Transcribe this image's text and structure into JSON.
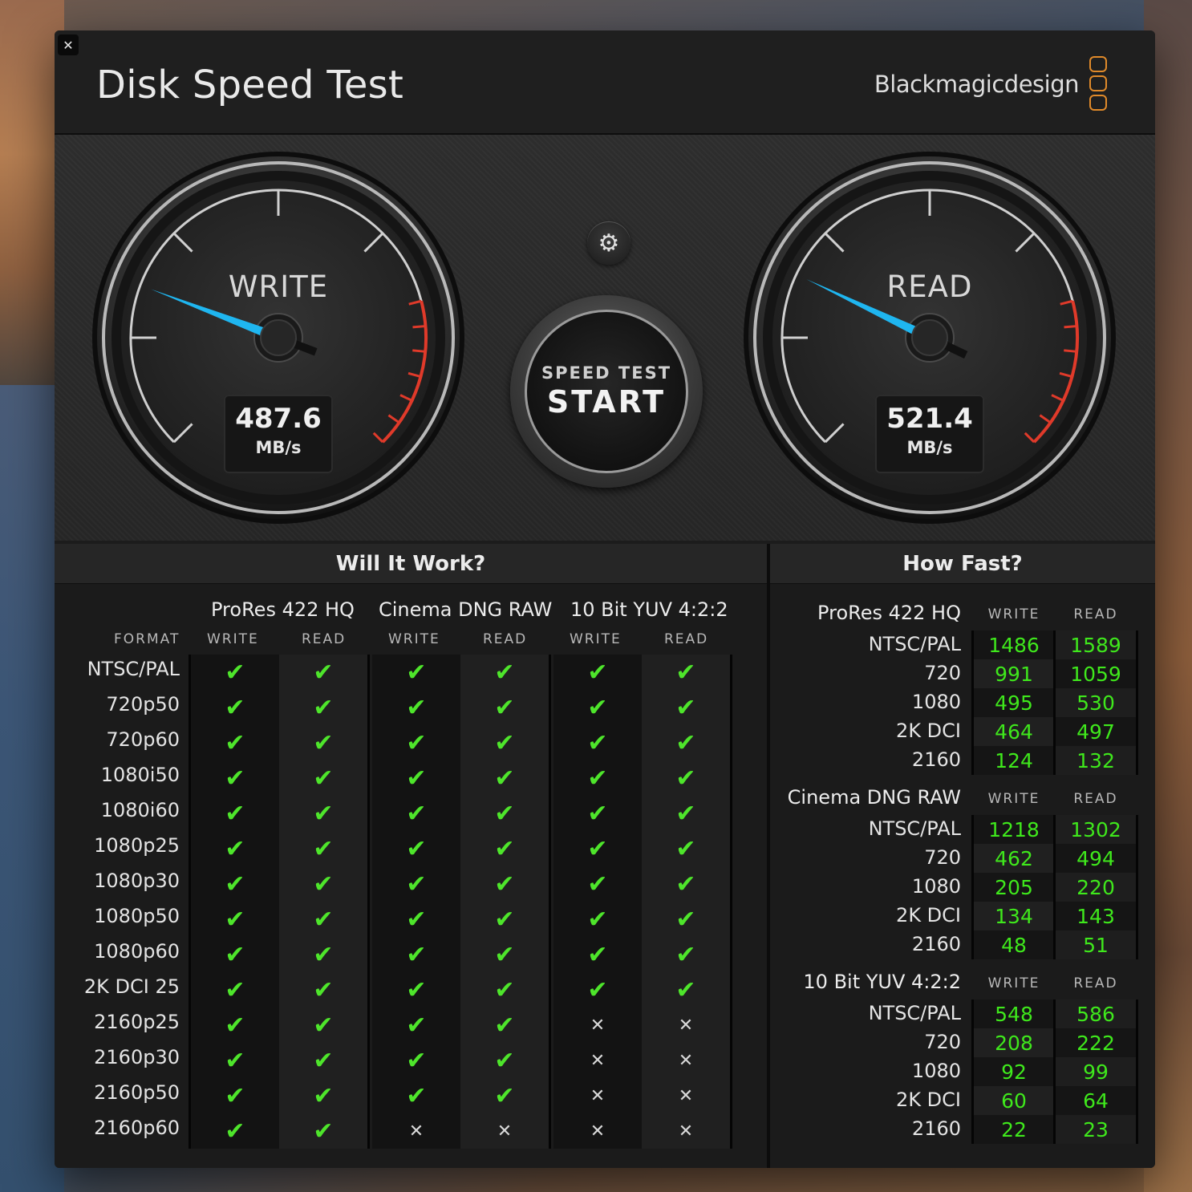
{
  "window": {
    "title": "Disk Speed Test",
    "brand": "Blackmagicdesign",
    "close_icon": "close-icon"
  },
  "gauges": {
    "write": {
      "label": "WRITE",
      "value": "487.6",
      "unit": "MB/s",
      "reading": 487.6
    },
    "read": {
      "label": "READ",
      "value": "521.4",
      "unit": "MB/s",
      "reading": 521.4
    }
  },
  "controls": {
    "start_top": "SPEED TEST",
    "start_main": "START",
    "settings_icon": "gear-icon"
  },
  "colors": {
    "needle": "#1fb6f0",
    "redline": "#e03a2a",
    "ok": "#4ee52b",
    "value": "#3fe81c",
    "brand_logo": "#e08a2a"
  },
  "will_it_work": {
    "title": "Will It Work?",
    "format_header": "FORMAT",
    "groups": [
      {
        "name": "ProRes 422 HQ",
        "write": "WRITE",
        "read": "READ"
      },
      {
        "name": "Cinema DNG RAW",
        "write": "WRITE",
        "read": "READ"
      },
      {
        "name": "10 Bit YUV 4:2:2",
        "write": "WRITE",
        "read": "READ"
      }
    ],
    "rows": [
      {
        "format": "NTSC/PAL",
        "result": [
          1,
          1,
          1,
          1,
          1,
          1
        ]
      },
      {
        "format": "720p50",
        "result": [
          1,
          1,
          1,
          1,
          1,
          1
        ]
      },
      {
        "format": "720p60",
        "result": [
          1,
          1,
          1,
          1,
          1,
          1
        ]
      },
      {
        "format": "1080i50",
        "result": [
          1,
          1,
          1,
          1,
          1,
          1
        ]
      },
      {
        "format": "1080i60",
        "result": [
          1,
          1,
          1,
          1,
          1,
          1
        ]
      },
      {
        "format": "1080p25",
        "result": [
          1,
          1,
          1,
          1,
          1,
          1
        ]
      },
      {
        "format": "1080p30",
        "result": [
          1,
          1,
          1,
          1,
          1,
          1
        ]
      },
      {
        "format": "1080p50",
        "result": [
          1,
          1,
          1,
          1,
          1,
          1
        ]
      },
      {
        "format": "1080p60",
        "result": [
          1,
          1,
          1,
          1,
          1,
          1
        ]
      },
      {
        "format": "2K DCI 25",
        "result": [
          1,
          1,
          1,
          1,
          1,
          1
        ]
      },
      {
        "format": "2160p25",
        "result": [
          1,
          1,
          1,
          1,
          0,
          0
        ]
      },
      {
        "format": "2160p30",
        "result": [
          1,
          1,
          1,
          1,
          0,
          0
        ]
      },
      {
        "format": "2160p50",
        "result": [
          1,
          1,
          1,
          1,
          0,
          0
        ]
      },
      {
        "format": "2160p60",
        "result": [
          1,
          1,
          0,
          0,
          0,
          0
        ]
      }
    ],
    "ok_glyph": "✔",
    "no_glyph": "✕"
  },
  "how_fast": {
    "title": "How Fast?",
    "sections": [
      {
        "name": "ProRes 422 HQ",
        "write": "WRITE",
        "read": "READ",
        "rows": [
          {
            "format": "NTSC/PAL",
            "write": "1486",
            "read": "1589"
          },
          {
            "format": "720",
            "write": "991",
            "read": "1059"
          },
          {
            "format": "1080",
            "write": "495",
            "read": "530"
          },
          {
            "format": "2K DCI",
            "write": "464",
            "read": "497"
          },
          {
            "format": "2160",
            "write": "124",
            "read": "132"
          }
        ]
      },
      {
        "name": "Cinema DNG RAW",
        "write": "WRITE",
        "read": "READ",
        "rows": [
          {
            "format": "NTSC/PAL",
            "write": "1218",
            "read": "1302"
          },
          {
            "format": "720",
            "write": "462",
            "read": "494"
          },
          {
            "format": "1080",
            "write": "205",
            "read": "220"
          },
          {
            "format": "2K DCI",
            "write": "134",
            "read": "143"
          },
          {
            "format": "2160",
            "write": "48",
            "read": "51"
          }
        ]
      },
      {
        "name": "10 Bit YUV 4:2:2",
        "write": "WRITE",
        "read": "READ",
        "rows": [
          {
            "format": "NTSC/PAL",
            "write": "548",
            "read": "586"
          },
          {
            "format": "720",
            "write": "208",
            "read": "222"
          },
          {
            "format": "1080",
            "write": "92",
            "read": "99"
          },
          {
            "format": "2K DCI",
            "write": "60",
            "read": "64"
          },
          {
            "format": "2160",
            "write": "22",
            "read": "23"
          }
        ]
      }
    ]
  }
}
